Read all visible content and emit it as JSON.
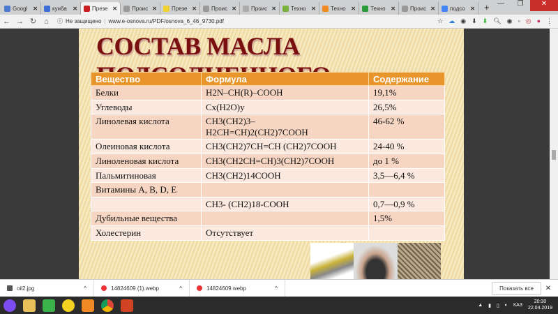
{
  "browser": {
    "tabs": [
      {
        "label": "Googl",
        "color": "#4a7bd0"
      },
      {
        "label": "кунба",
        "color": "#3b6fd6"
      },
      {
        "label": "Презе",
        "color": "#c91f1f",
        "active": true
      },
      {
        "label": "Проис",
        "color": "#999"
      },
      {
        "label": "Презе",
        "color": "#f1d232"
      },
      {
        "label": "Проис",
        "color": "#999"
      },
      {
        "label": "Проис",
        "color": "#aaa"
      },
      {
        "label": "Техно",
        "color": "#7ab33a"
      },
      {
        "label": "Техно",
        "color": "#f08a24"
      },
      {
        "label": "Техно",
        "color": "#2a9d3a"
      },
      {
        "label": "Проис",
        "color": "#999"
      },
      {
        "label": "подсо",
        "color": "#4285f4"
      }
    ],
    "new_tab": "+",
    "security": "Не защищено",
    "url": "www.e-osnova.ru/PDF/osnova_6_46_9730.pdf"
  },
  "slide": {
    "title": "СОСТАВ МАСЛА ПОДСОЛНЕЧНОГО",
    "headers": [
      "Вещество",
      "Формула",
      "Содержание"
    ],
    "rows": [
      [
        "Белки",
        "H2N–CH(R)–COOH",
        "19,1%"
      ],
      [
        "Углеводы",
        "Cx(H2O)y",
        "26,5%"
      ],
      [
        "Линолевая кислота",
        "CH3(CH2)3–\nH2CH=CH)2(CH2)7COOH",
        "46-62 %"
      ],
      [
        "Олеиновая кислота",
        "CH3(CH2)7CH=CH (CH2)7COOH",
        "24-40 %"
      ],
      [
        "Линоленовая кислота",
        " CH3(CH2CH=CH)3(CH2)7COOH",
        "до 1 %"
      ],
      [
        "Пальмитиновая",
        "CH3(CH2)14COOH",
        "3,5—6,4 %"
      ],
      [
        "Витамины A, B, D, E",
        "",
        ""
      ],
      [
        "",
        "CH3- (CH2)18-COOH",
        "0,7—0,9 %"
      ],
      [
        "Дубильные  вещества",
        "",
        "1,5%"
      ],
      [
        "Холестерин",
        "Отсутствует",
        ""
      ]
    ]
  },
  "downloads": {
    "items": [
      "oil2.jpg",
      "14824609 (1).webp",
      "14824609.webp"
    ],
    "show_all": "Показать все"
  },
  "taskbar": {
    "lang": "КАЗ",
    "time": "20:30",
    "date": "22.04.2019"
  }
}
